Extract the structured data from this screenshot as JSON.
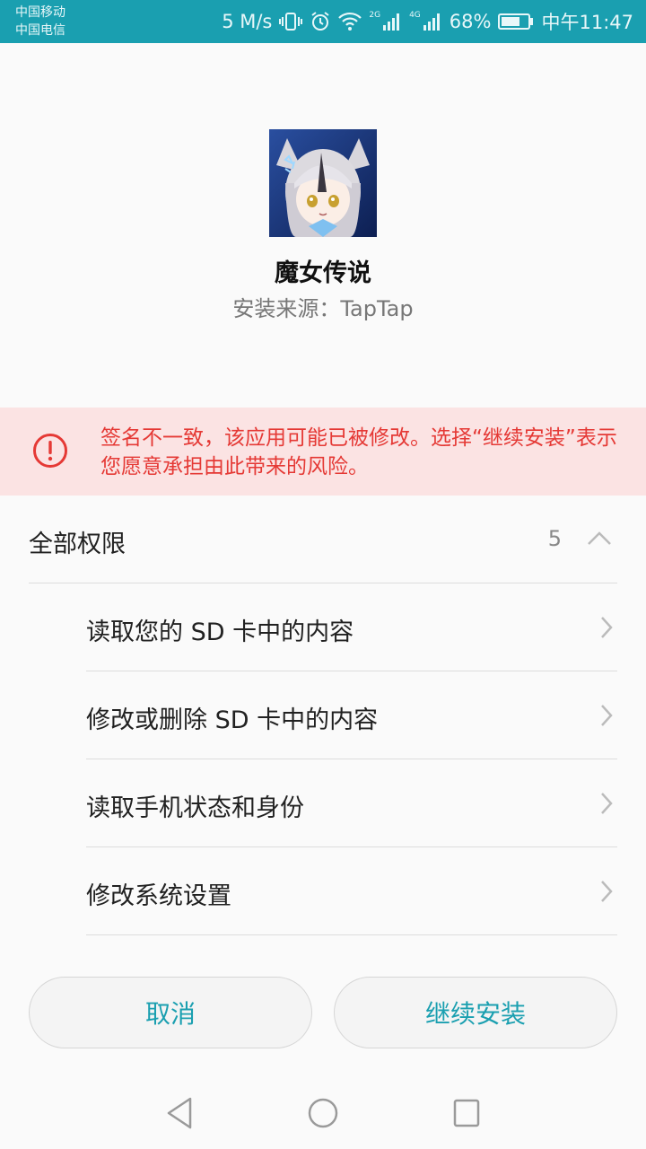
{
  "status_bar": {
    "carrier_1": "中国移动",
    "carrier_2": "中国电信",
    "net_speed": "5 M/s",
    "sim1_tag": "2G",
    "sim2_tag": "4G",
    "battery": "68%",
    "time": "中午11:47",
    "color": "#1a9fb0"
  },
  "app": {
    "name": "魔女传说",
    "source": "安装来源：TapTap"
  },
  "warning": {
    "text": "签名不一致，该应用可能已被修改。选择“继续安装”表示您愿意承担由此带来的风险。",
    "color": "#e53935",
    "background": "#fbe3e3",
    "icon": "alert-circle-icon"
  },
  "permissions": {
    "title": "全部权限",
    "count": "5",
    "expanded": true,
    "items": [
      {
        "label": "读取您的 SD 卡中的内容"
      },
      {
        "label": "修改或删除 SD 卡中的内容"
      },
      {
        "label": "读取手机状态和身份"
      },
      {
        "label": "修改系统设置"
      }
    ]
  },
  "buttons": {
    "cancel": "取消",
    "install": "继续安装",
    "accent": "#1a9fb0"
  },
  "nav_bar": {
    "icons": [
      "back-triangle-icon",
      "home-circle-icon",
      "recents-square-icon"
    ]
  }
}
